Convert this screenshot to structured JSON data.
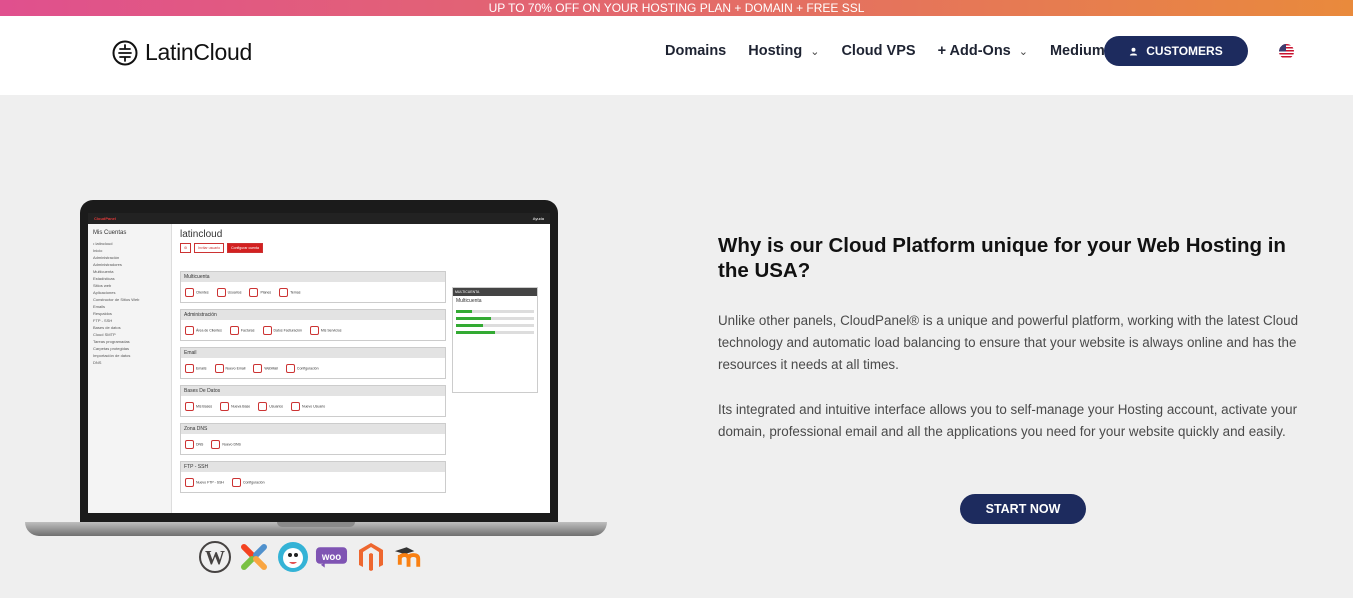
{
  "promo": {
    "text": "UP TO 70% OFF ON YOUR HOSTING PLAN + DOMAIN + FREE SSL"
  },
  "brand": {
    "name": "LatinCloud"
  },
  "nav": {
    "items": [
      {
        "label": "Domains",
        "dropdown": false
      },
      {
        "label": "Hosting",
        "dropdown": true
      },
      {
        "label": "Cloud VPS",
        "dropdown": false
      },
      {
        "label": "+ Add-Ons",
        "dropdown": true
      },
      {
        "label": "Medium",
        "dropdown": false
      }
    ],
    "customers_label": "CUSTOMERS",
    "language_flag": "us-flag-icon"
  },
  "mockup": {
    "app_brand": "CloudPanel",
    "help_label": "Ayuda",
    "sidebar_title": "Mis Cuentas",
    "sidebar_account": "• latincloud",
    "sidebar_items": [
      "Inicio",
      "Administración",
      "Administradores",
      "Multicuenta",
      "Estadísticas",
      "Sitios web",
      "Aplicaciones",
      "Constructor de Sitios Web",
      "Emails",
      "Respaldos",
      "FTP - SSH",
      "Bases de datos",
      "Cloud SMTP",
      "Tareas programadas",
      "Carpetas protegidas",
      "Importación de datos",
      "DNS"
    ],
    "title": "latincloud",
    "buttons": [
      "⚙",
      "Invitar usuario",
      "Configurar cuenta"
    ],
    "sections": [
      {
        "title": "Multicuenta",
        "items": [
          "Clientes",
          "Usuarios",
          "Planes",
          "Temas"
        ]
      },
      {
        "title": "Administración",
        "items": [
          "Área de Clientes",
          "Facturas",
          "Datos Facturación",
          "Mis Servicios"
        ]
      },
      {
        "title": "Email",
        "items": [
          "Emails",
          "Nuevo Email",
          "WebMail",
          "Configuración"
        ]
      },
      {
        "title": "Bases De Datos",
        "items": [
          "Mis Bases",
          "Nueva Base",
          "Usuarios",
          "Nuevo Usuario"
        ]
      },
      {
        "title": "Zona DNS",
        "items": [
          "DNS",
          "Nuevo DNS"
        ]
      },
      {
        "title": "FTP - SSH",
        "items": [
          "Nuevo FTP - SSH",
          "Configuración"
        ]
      }
    ],
    "right_panel_title": "MULTICUENTA",
    "right_panel_subtitle": "Multicuenta"
  },
  "hero": {
    "heading": "Why is our Cloud Platform unique for your Web Hosting in the USA?",
    "paragraph1": "Unlike other panels, CloudPanel® is a unique and powerful platform, working with the latest Cloud technology and automatic load balancing to ensure that your website is always online and has the resources it needs at all times.",
    "paragraph2": "Its integrated and intuitive interface allows you to self-manage your Hosting account, activate your domain, professional email and all the applications you need for your website quickly and easily.",
    "cta_label": "START NOW"
  },
  "app_logos": [
    "wordpress-icon",
    "joomla-icon",
    "prestashop-icon",
    "woocommerce-icon",
    "magento-icon",
    "moodle-icon"
  ],
  "colors": {
    "navy": "#1d2b5e",
    "promo_start": "#e0508e",
    "promo_end": "#e98a3c",
    "hero_bg": "#efefef"
  }
}
